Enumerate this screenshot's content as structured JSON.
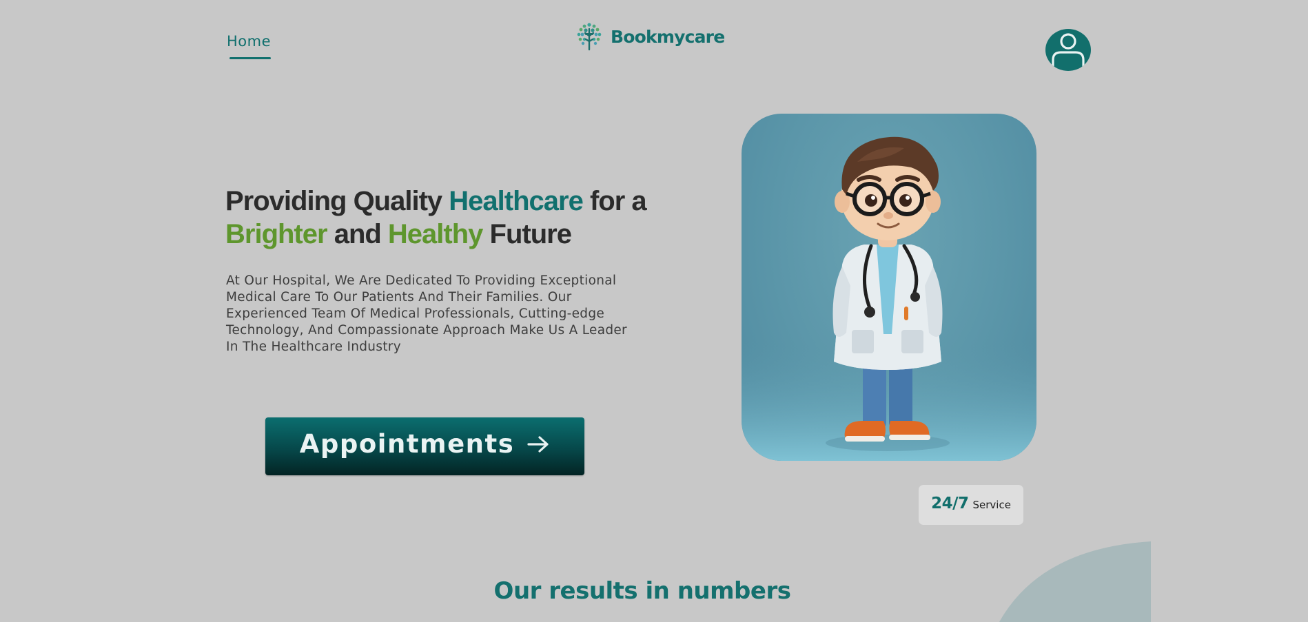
{
  "header": {
    "nav_home": "Home",
    "brand_name": "Bookmycare",
    "avatar_icon": "user-icon"
  },
  "hero": {
    "headline": {
      "part1": "Providing Quality ",
      "highlight1": "Healthcare",
      "part2": " for a",
      "highlight2": "Brighter",
      "part3": " and ",
      "highlight3": "Healthy",
      "part4": " Future"
    },
    "description": "At Our Hospital, We Are Dedicated To Providing Exceptional Medical Care To Our Patients And Their Families. Our Experienced Team Of Medical Professionals, Cutting-edge Technology, And Compassionate Approach Make Us A Leader In The Healthcare Industry",
    "cta_label": "Appointments",
    "cta_icon": "arrow-right-icon",
    "image_icon": "doctor-illustration"
  },
  "badge": {
    "number": "24/7",
    "label": "Service"
  },
  "results": {
    "title": "Our results in numbers"
  },
  "colors": {
    "background": "#c8c8c8",
    "primary_teal": "#11706e",
    "accent_green": "#5e962d",
    "text_dark": "#2b2b2b"
  }
}
